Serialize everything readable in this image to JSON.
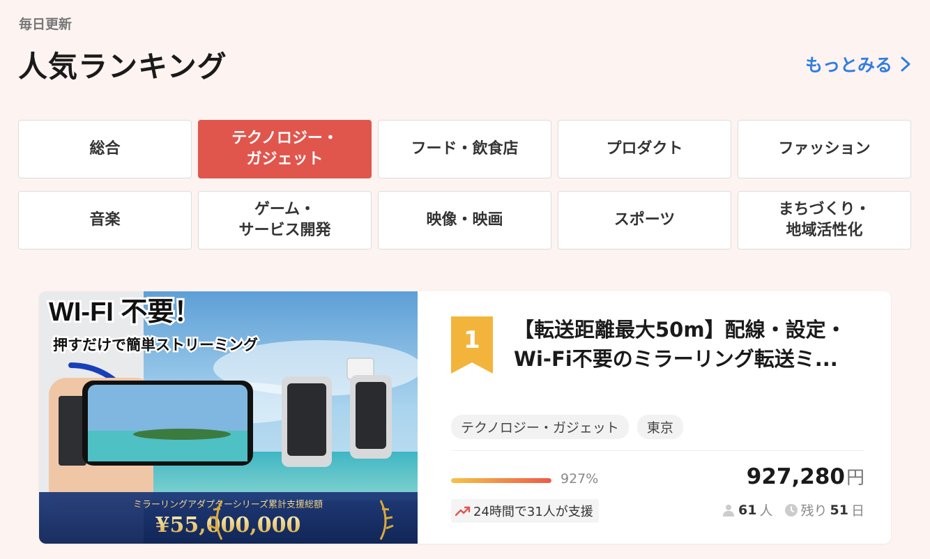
{
  "header": {
    "eyebrow": "毎日更新",
    "title": "人気ランキング",
    "more_label": "もっとみる"
  },
  "categories": [
    {
      "label": "総合",
      "active": false
    },
    {
      "label": "テクノロジー・\nガジェット",
      "active": true
    },
    {
      "label": "フード・飲食店",
      "active": false
    },
    {
      "label": "プロダクト",
      "active": false
    },
    {
      "label": "ファッション",
      "active": false
    },
    {
      "label": "音楽",
      "active": false
    },
    {
      "label": "ゲーム・\nサービス開発",
      "active": false
    },
    {
      "label": "映像・映画",
      "active": false
    },
    {
      "label": "スポーツ",
      "active": false
    },
    {
      "label": "まちづくり・\n地域活性化",
      "active": false
    }
  ],
  "project": {
    "rank": "1",
    "title": "【転送距離最大50m】配線・設定・Wi-Fi不要のミラーリング転送ミ...",
    "tags": [
      "テクノロジー・ガジェット",
      "東京"
    ],
    "progress_percent": 927,
    "progress_label": "927%",
    "amount": "927,280",
    "currency": "円",
    "trend_text": "24時間で31人が支援",
    "supporters": "61",
    "supporters_unit": "人",
    "remaining_prefix": "残り",
    "remaining_days": "51",
    "remaining_unit": "日",
    "image": {
      "headline": "WI-FI 不要！",
      "subline": "押すだけで簡単ストリーミング",
      "banner_caption": "ミラーリングアダプターシリーズ累計支援総額",
      "banner_amount": "¥55,000,000"
    }
  },
  "colors": {
    "accent": "#e0564d",
    "link": "#2f7de0",
    "rank_badge": "#f3b43c",
    "background": "#fdf3f1"
  }
}
